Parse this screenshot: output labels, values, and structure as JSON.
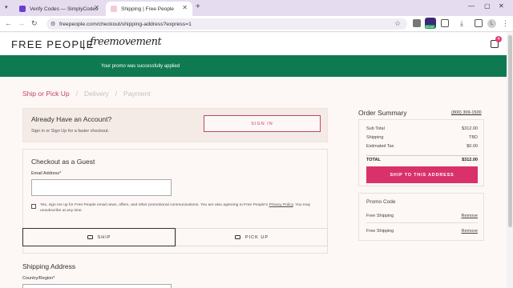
{
  "browser": {
    "tabs": [
      {
        "title": "Verify Codes — SimplyCodes",
        "active": false
      },
      {
        "title": "Shipping | Free People",
        "active": true
      }
    ],
    "url": "freepeople.com/checkout/shipping-address?express=1",
    "profile_initial": "L",
    "extension_badge": "Dove"
  },
  "header": {
    "logo": "FREE PEOPLE",
    "logo_script": "freemovement",
    "cart_count": "4"
  },
  "promo_banner": "Your promo was successfully applied",
  "steps": [
    "Ship or Pick Up",
    "Delivery",
    "Payment"
  ],
  "account": {
    "title": "Already Have an Account?",
    "subtitle": "Sign in or Sign Up for a faster checkout.",
    "signin_label": "SIGN IN"
  },
  "guest": {
    "title": "Checkout as a Guest",
    "email_label": "Email Address*",
    "email_value": "",
    "consent_text": "Yes, sign me up for Free People email news, offers, and other promotional communications. You are also agreeing to Free People's",
    "consent_link": "Privacy Policy",
    "consent_tail": ". You may unsubscribe at any time."
  },
  "delivery_options": {
    "ship_label": "SHIP",
    "pickup_label": "PICK UP"
  },
  "shipping_address": {
    "title": "Shipping Address",
    "country_label": "Country/Region*"
  },
  "summary": {
    "title": "Order Summary",
    "phone": "(800) 309-1500",
    "rows": [
      {
        "label": "Sub Total",
        "value": "$312.00"
      },
      {
        "label": "Shipping",
        "value": "TBD"
      },
      {
        "label": "Estimated Tax",
        "value": "$0.00"
      }
    ],
    "total_label": "TOTAL",
    "total_value": "$312.00",
    "cta": "SHIP TO THIS ADDRESS"
  },
  "promo_code": {
    "title": "Promo Code",
    "items": [
      {
        "label": "Free Shipping",
        "action": "Remove"
      },
      {
        "label": "Free Shipping",
        "action": "Remove"
      }
    ]
  },
  "colors": {
    "accent": "#c2446a",
    "cta": "#d9326a",
    "banner": "#0f7a52"
  }
}
